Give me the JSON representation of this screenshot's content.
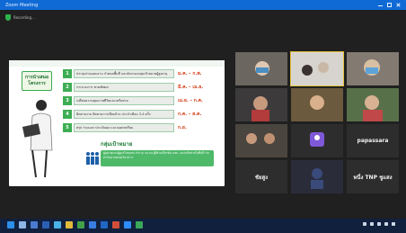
{
  "window": {
    "title": "Zoom Meeting"
  },
  "meeting": {
    "top_label": "Recording...",
    "status_text": ""
  },
  "slide": {
    "title": "การนำเสนอ โครงการ",
    "rows": [
      {
        "num": "1",
        "text": "ประชุมร่วมแผนงาน กำหนดพื้นที่ และคัดกรองกลุ่มเป้าหมายผู้สูงอายุ",
        "date": "ม.ค. – ก.พ."
      },
      {
        "num": "2",
        "text": "กระบวนการ พายเลิศผล",
        "date": "มี.ค. – เม.ย."
      },
      {
        "num": "3",
        "text": "เปลี่ยนความคุณภาพชีวิตและเครือข่าย",
        "date": "เม.ย. – ก.ค."
      },
      {
        "num": "4",
        "text": "ติดตามงาน ติดตามการเยี่ยมบ้าน ประจำเดือน 3-4 ครั้ง",
        "date": "ก.ค. – ส.ค."
      },
      {
        "num": "5",
        "text": "สรุป ร่วมแลก ประเมินผล และถอดบทเรียน",
        "date": "ก.ย."
      }
    ],
    "group_title": "กลุ่มเป้าหมาย",
    "group_text": "ผู้สูงอายุและผู้ดูแลในชุมชน จำนวน 40 คน ผู้มีส่วนเกี่ยวข้อง อสม. และเครือข่ายในพื้นที่ ร่วมดำเนินงานตลอดโครงการ"
  },
  "participants": [
    {
      "name": "",
      "big": ""
    },
    {
      "name": "",
      "big": ""
    },
    {
      "name": "",
      "big": ""
    },
    {
      "name": "",
      "big": ""
    },
    {
      "name": "",
      "big": ""
    },
    {
      "name": "",
      "big": ""
    },
    {
      "name": "",
      "big": ""
    },
    {
      "name": "",
      "big": ""
    },
    {
      "name": "",
      "big": "papassara"
    },
    {
      "name": "",
      "big": "ชัยสูง"
    },
    {
      "name": "",
      "big": ""
    },
    {
      "name": "",
      "big": "หนึ่ง TNP ชูแสง"
    }
  ],
  "taskbar": {
    "time": "",
    "date": ""
  },
  "colors": {
    "accent": "#0f6ad6",
    "slide_green": "#3dae54",
    "date_red": "#d43c16",
    "active_tile": "#e6c33b"
  }
}
